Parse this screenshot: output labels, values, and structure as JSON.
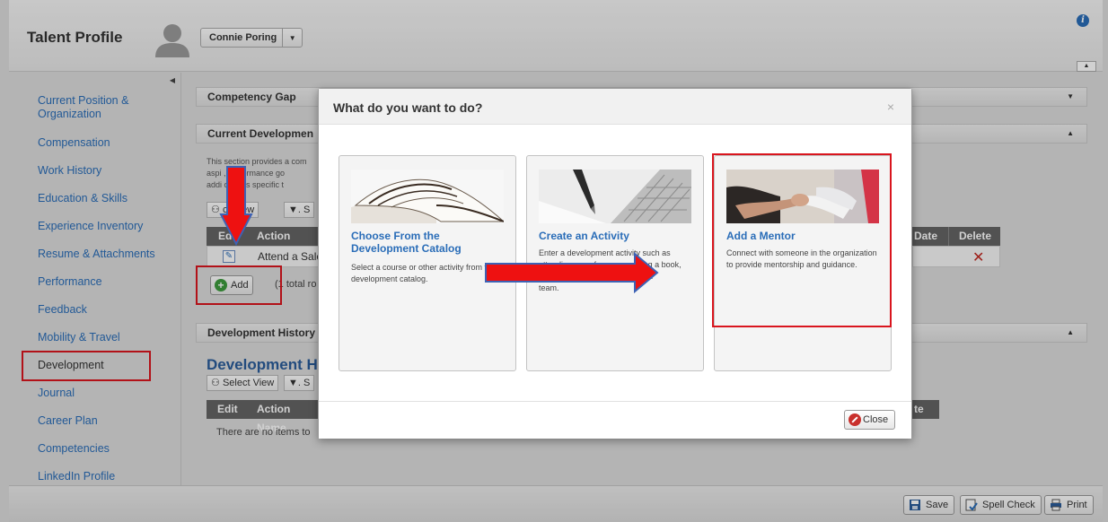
{
  "header": {
    "title": "Talent Profile",
    "user_name": "Connie Poring"
  },
  "sidebar": {
    "items": [
      {
        "label": "Current Position & Organization"
      },
      {
        "label": "Compensation"
      },
      {
        "label": "Work History"
      },
      {
        "label": "Education & Skills"
      },
      {
        "label": "Experience Inventory"
      },
      {
        "label": "Resume & Attachments"
      },
      {
        "label": "Performance"
      },
      {
        "label": "Feedback"
      },
      {
        "label": "Mobility & Travel"
      },
      {
        "label": "Development"
      },
      {
        "label": "Journal"
      },
      {
        "label": "Career Plan"
      },
      {
        "label": "Competencies"
      },
      {
        "label": "LinkedIn Profile"
      }
    ],
    "active": "Development"
  },
  "content": {
    "competency_gap": "Competency Gap",
    "current_development": "Current Developmen",
    "desc_lines": [
      "This section provides a com",
      "aspi   , performance go",
      "addi   options specific t"
    ],
    "select_view": "ct View",
    "filter_label": "S",
    "grid_headers": {
      "edit": "Ed",
      "action_name": "Action Name",
      "due_date": "Date",
      "delete": "Delete"
    },
    "row_action": "Attend a Sale",
    "add_label": "Add",
    "total_rows": "(1 total ro",
    "dev_history_header": "Development History",
    "dev_history_title": "Development His",
    "select_view_2": "Select View",
    "filter_label_2": "S",
    "grid2_headers": {
      "edit": "Edit",
      "action_name": "Action Name",
      "date": "te"
    },
    "no_items": "There are no items to"
  },
  "modal": {
    "title": "What do you want to do?",
    "close_x": "×",
    "cards": [
      {
        "title": "Choose From the Development Catalog",
        "text": "Select a course or other activity from the development catalog."
      },
      {
        "title": "Create an Activity",
        "text_lines": [
          "Enter a development activity such as",
          "attending a conference, reading a book,",
          "or participating in a professional",
          "team."
        ]
      },
      {
        "title": "Add a Mentor",
        "text": "Connect with someone in the organization to provide mentorship and guidance."
      }
    ],
    "close_label": "Close"
  },
  "footer": {
    "save": "Save",
    "spell_check": "Spell Check",
    "print": "Print"
  },
  "colors": {
    "link": "#2a6db8",
    "highlight": "#d9151e",
    "arrow_fill": "#ee1111",
    "arrow_outline": "#3d62b5",
    "grid_header": "#646464"
  }
}
